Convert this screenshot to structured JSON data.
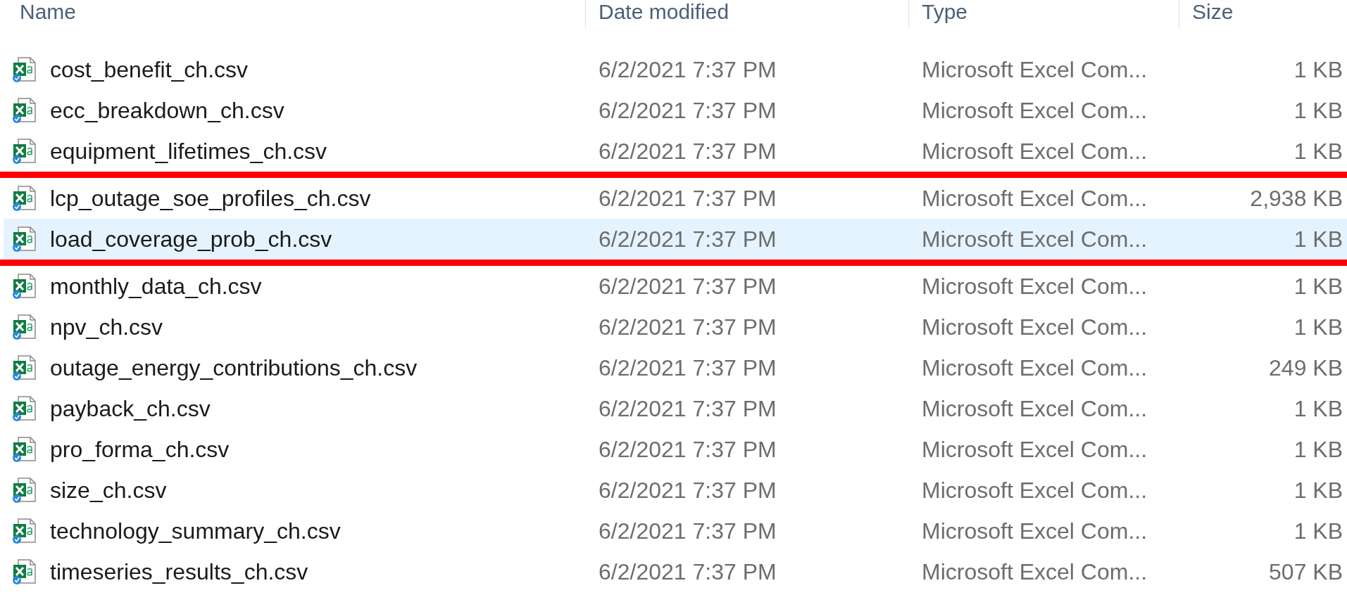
{
  "columns": [
    {
      "label": "Name"
    },
    {
      "label": "Date modified"
    },
    {
      "label": "Type"
    },
    {
      "label": "Size"
    }
  ],
  "rows": [
    {
      "name": "cost_benefit_ch.csv",
      "date": "6/2/2021 7:37 PM",
      "type": "Microsoft Excel Com...",
      "size": "1 KB",
      "selected": false,
      "red_line_below": false
    },
    {
      "name": "ecc_breakdown_ch.csv",
      "date": "6/2/2021 7:37 PM",
      "type": "Microsoft Excel Com...",
      "size": "1 KB",
      "selected": false,
      "red_line_below": false
    },
    {
      "name": "equipment_lifetimes_ch.csv",
      "date": "6/2/2021 7:37 PM",
      "type": "Microsoft Excel Com...",
      "size": "1 KB",
      "selected": false,
      "red_line_below": true
    },
    {
      "name": "lcp_outage_soe_profiles_ch.csv",
      "date": "6/2/2021 7:37 PM",
      "type": "Microsoft Excel Com...",
      "size": "2,938 KB",
      "selected": false,
      "red_line_below": false
    },
    {
      "name": "load_coverage_prob_ch.csv",
      "date": "6/2/2021 7:37 PM",
      "type": "Microsoft Excel Com...",
      "size": "1 KB",
      "selected": true,
      "red_line_below": true
    },
    {
      "name": "monthly_data_ch.csv",
      "date": "6/2/2021 7:37 PM",
      "type": "Microsoft Excel Com...",
      "size": "1 KB",
      "selected": false,
      "red_line_below": false
    },
    {
      "name": "npv_ch.csv",
      "date": "6/2/2021 7:37 PM",
      "type": "Microsoft Excel Com...",
      "size": "1 KB",
      "selected": false,
      "red_line_below": false
    },
    {
      "name": "outage_energy_contributions_ch.csv",
      "date": "6/2/2021 7:37 PM",
      "type": "Microsoft Excel Com...",
      "size": "249 KB",
      "selected": false,
      "red_line_below": false
    },
    {
      "name": "payback_ch.csv",
      "date": "6/2/2021 7:37 PM",
      "type": "Microsoft Excel Com...",
      "size": "1 KB",
      "selected": false,
      "red_line_below": false
    },
    {
      "name": "pro_forma_ch.csv",
      "date": "6/2/2021 7:37 PM",
      "type": "Microsoft Excel Com...",
      "size": "1 KB",
      "selected": false,
      "red_line_below": false
    },
    {
      "name": "size_ch.csv",
      "date": "6/2/2021 7:37 PM",
      "type": "Microsoft Excel Com...",
      "size": "1 KB",
      "selected": false,
      "red_line_below": false
    },
    {
      "name": "technology_summary_ch.csv",
      "date": "6/2/2021 7:37 PM",
      "type": "Microsoft Excel Com...",
      "size": "1 KB",
      "selected": false,
      "red_line_below": false
    },
    {
      "name": "timeseries_results_ch.csv",
      "date": "6/2/2021 7:37 PM",
      "type": "Microsoft Excel Com...",
      "size": "507 KB",
      "selected": false,
      "red_line_below": false
    }
  ]
}
